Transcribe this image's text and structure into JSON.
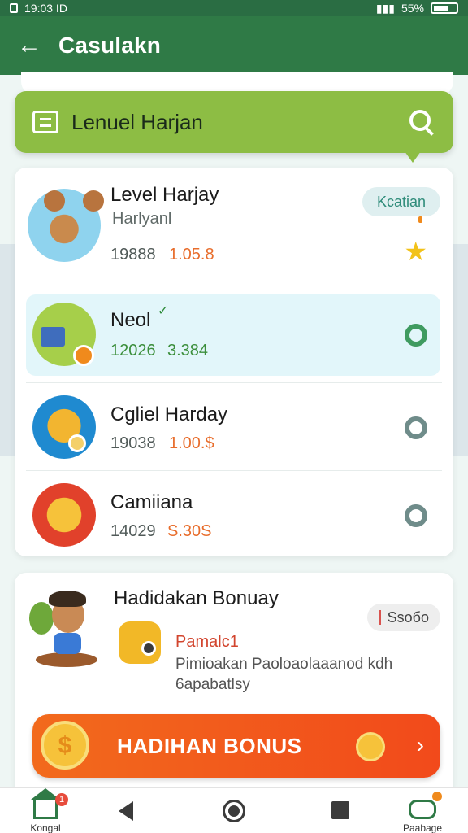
{
  "status": {
    "time": "19:03 ID",
    "battery": "55%"
  },
  "appbar": {
    "title": "Casulakn",
    "back_icon": "arrow-left-icon"
  },
  "search": {
    "label": "Lenuel Harjan",
    "icon_left": "list-icon",
    "icon_right": "search-icon",
    "color": "#8dbd44"
  },
  "levels": [
    {
      "title": "Level Harjay",
      "subtitle": "Harlyanl",
      "num": "19888",
      "value": "1.05.8",
      "tag": "Kcatian",
      "icon": "star-icon"
    },
    {
      "title": "Neol",
      "num": "12026",
      "value": "3.384",
      "selected": true
    },
    {
      "title": "Cgliel Harday",
      "num": "19038",
      "value": "1.00.$"
    },
    {
      "title": "Camiiana",
      "num": "14029",
      "value": "S.30S"
    }
  ],
  "bonus": {
    "title": "Hadidakan Bonuay",
    "tag": "Ssoбo",
    "label": "Pamalc1",
    "desc": "Pimioakan Paoloaolaaanod kdh 6apabatlsy",
    "button": "HADIHAN BONUS"
  },
  "nav": {
    "home_label": "Kongal",
    "profile_label": "Paabage",
    "badge": "1"
  },
  "colors": {
    "primary": "#2f7a46",
    "accent": "#f26a1c",
    "selected_bg": "#e2f6fa"
  }
}
